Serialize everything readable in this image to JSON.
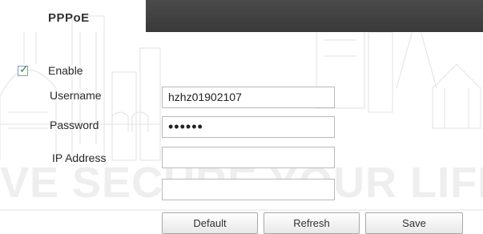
{
  "section": {
    "title": "PPPoE"
  },
  "form": {
    "enable": {
      "label": "Enable",
      "checked": true
    },
    "username": {
      "label": "Username",
      "value": "hzhz01902107"
    },
    "password": {
      "label": "Password",
      "value": "••••••"
    },
    "ip_address": {
      "label": "IP Address",
      "value": ""
    },
    "extra_field": {
      "value": ""
    }
  },
  "buttons": {
    "default_label": "Default",
    "refresh_label": "Refresh",
    "save_label": "Save"
  },
  "watermark": {
    "text": "VE SECURE YOUR LIFE"
  },
  "colors": {
    "header_bar": "#3f3f3f",
    "checkbox_border": "#7a9cc9",
    "field_border": "#b9b9b9"
  }
}
